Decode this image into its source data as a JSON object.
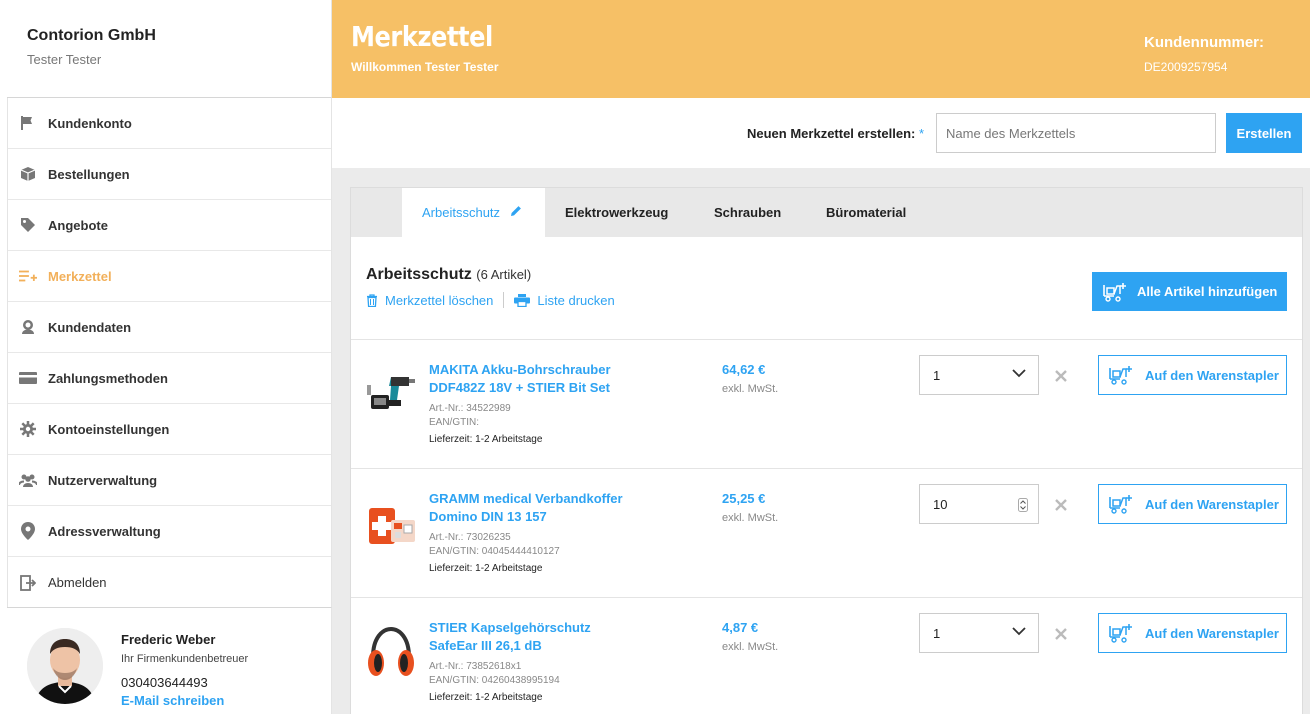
{
  "company": {
    "name": "Contorion GmbH",
    "user": "Tester Tester"
  },
  "nav": {
    "items": [
      {
        "label": "Kundenkonto",
        "icon": "flag-icon"
      },
      {
        "label": "Bestellungen",
        "icon": "box-icon"
      },
      {
        "label": "Angebote",
        "icon": "tag-icon"
      },
      {
        "label": "Merkzettel",
        "icon": "list-add-icon",
        "active": true
      },
      {
        "label": "Kundendaten",
        "icon": "user-icon"
      },
      {
        "label": "Zahlungsmethoden",
        "icon": "credit-card-icon"
      },
      {
        "label": "Kontoeinstellungen",
        "icon": "gear-icon"
      },
      {
        "label": "Nutzerverwaltung",
        "icon": "users-icon"
      },
      {
        "label": "Adressverwaltung",
        "icon": "location-pin-icon"
      },
      {
        "label": "Abmelden",
        "icon": "logout-icon"
      }
    ]
  },
  "advisor": {
    "name": "Frederic Weber",
    "role": "Ihr Firmenkundenbetreuer",
    "phone": "030403644493",
    "email_label": "E-Mail schreiben"
  },
  "header": {
    "title": "Merkzettel",
    "welcome": "Willkommen Tester Tester",
    "customer_number_label": "Kundennummer:",
    "customer_number": "DE2009257954"
  },
  "create": {
    "label": "Neuen Merkzettel erstellen:",
    "required_mark": "*",
    "placeholder": "Name des Merkzettels",
    "button": "Erstellen"
  },
  "tabs": [
    {
      "label": "Arbeitsschutz",
      "active": true
    },
    {
      "label": "Elektrowerkzeug"
    },
    {
      "label": "Schrauben"
    },
    {
      "label": "Büromaterial"
    }
  ],
  "list": {
    "title": "Arbeitsschutz",
    "count": "(6 Artikel)",
    "delete_label": "Merkzettel löschen",
    "print_label": "Liste drucken",
    "add_all_label": "Alle Artikel hinzufügen"
  },
  "items": [
    {
      "name": "MAKITA Akku-Bohrschrauber DDF482Z 18V + STIER Bit Set",
      "art": "Art.-Nr.: 34522989",
      "ean": "EAN/GTIN:",
      "delivery": "Lieferzeit: 1-2 Arbeitstage",
      "price": "64,62 €",
      "vat": "exkl. MwSt.",
      "qty": "1",
      "qty_control": "select",
      "cart_label": "Auf den Warenstapler"
    },
    {
      "name": "GRAMM medical Verbandkoffer Domino DIN 13 157",
      "art": "Art.-Nr.: 73026235",
      "ean": "EAN/GTIN: 04045444410127",
      "delivery": "Lieferzeit: 1-2 Arbeitstage",
      "price": "25,25 €",
      "vat": "exkl. MwSt.",
      "qty": "10",
      "qty_control": "stepper",
      "cart_label": "Auf den Warenstapler"
    },
    {
      "name": "STIER Kapselgehörschutz SafeEar III 26,1 dB",
      "art": "Art.-Nr.: 73852618x1",
      "ean": "EAN/GTIN: 04260438995194",
      "delivery": "Lieferzeit: 1-2 Arbeitstage",
      "price": "4,87 €",
      "vat": "exkl. MwSt.",
      "qty": "1",
      "qty_control": "select",
      "cart_label": "Auf den Warenstapler"
    }
  ],
  "colors": {
    "accent": "#2ea3f2",
    "header": "#f6c066",
    "active_nav": "#f2b05a"
  }
}
